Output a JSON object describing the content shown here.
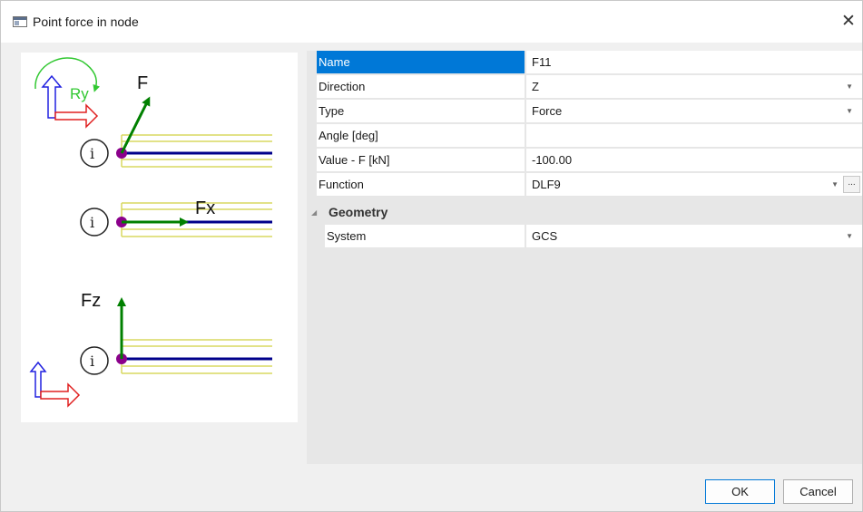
{
  "window": {
    "title": "Point force in node",
    "close_glyph": "✕"
  },
  "preview": {
    "node_label": "i",
    "ry_label": "Ry",
    "f_label": "F",
    "fx_label": "Fx",
    "fz_label": "Fz"
  },
  "properties": [
    {
      "name": "Name",
      "value": "F11",
      "dropdown": false
    },
    {
      "name": "Direction",
      "value": "Z",
      "dropdown": true
    },
    {
      "name": "Type",
      "value": "Force",
      "dropdown": true
    },
    {
      "name": "Angle [deg]",
      "value": "",
      "dropdown": false
    },
    {
      "name": "Value - F [kN]",
      "value": "-100.00",
      "dropdown": false
    },
    {
      "name": "Function",
      "value": "DLF9",
      "dropdown": true,
      "ellipsis": "..."
    }
  ],
  "groups": [
    {
      "label": "Geometry",
      "toggle_glyph": "◢",
      "items": [
        {
          "name": "System",
          "value": "GCS",
          "dropdown": true
        }
      ]
    }
  ],
  "dropdown_glyph": "▼",
  "buttons": {
    "ok": "OK",
    "cancel": "Cancel"
  },
  "colors": {
    "selection": "#0078d7",
    "beam": "#00008b",
    "node": "#8b008b",
    "force_arrow": "#008000",
    "outline": "#d8d860",
    "axis_x": "#e02020",
    "axis_z": "#2020e0",
    "rotation": "#32c832"
  },
  "icons": {
    "window": "window-icon",
    "close": "close-icon",
    "dropdown": "chevron-down-icon",
    "group_toggle": "collapse-triangle-icon"
  }
}
